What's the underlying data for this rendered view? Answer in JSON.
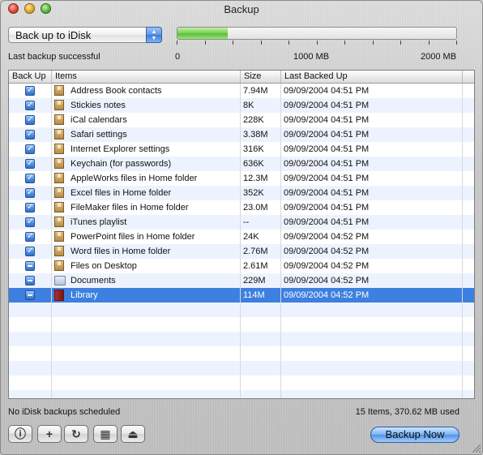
{
  "window": {
    "title": "Backup"
  },
  "destination": {
    "selected": "Back up to iDisk"
  },
  "status": {
    "last_backup": "Last backup successful"
  },
  "progress": {
    "fraction": 0.18,
    "labels": [
      "0",
      "1000 MB",
      "2000 MB"
    ]
  },
  "table": {
    "columns": [
      "Back Up",
      "Items",
      "Size",
      "Last Backed Up"
    ],
    "rows": [
      {
        "check": "on",
        "icon": "package-icon",
        "item": "Address Book contacts",
        "size": "7.94M",
        "date": "09/09/2004 04:51 PM"
      },
      {
        "check": "on",
        "icon": "package-icon",
        "item": "Stickies notes",
        "size": "8K",
        "date": "09/09/2004 04:51 PM"
      },
      {
        "check": "on",
        "icon": "package-icon",
        "item": "iCal calendars",
        "size": "228K",
        "date": "09/09/2004 04:51 PM"
      },
      {
        "check": "on",
        "icon": "package-icon",
        "item": "Safari settings",
        "size": "3.38M",
        "date": "09/09/2004 04:51 PM"
      },
      {
        "check": "on",
        "icon": "package-icon",
        "item": "Internet Explorer settings",
        "size": "316K",
        "date": "09/09/2004 04:51 PM"
      },
      {
        "check": "on",
        "icon": "package-icon",
        "item": "Keychain (for passwords)",
        "size": "636K",
        "date": "09/09/2004 04:51 PM"
      },
      {
        "check": "on",
        "icon": "package-icon",
        "item": "AppleWorks files in Home folder",
        "size": "12.3M",
        "date": "09/09/2004 04:51 PM"
      },
      {
        "check": "on",
        "icon": "package-icon",
        "item": "Excel files in Home folder",
        "size": "352K",
        "date": "09/09/2004 04:51 PM"
      },
      {
        "check": "on",
        "icon": "package-icon",
        "item": "FileMaker files in Home folder",
        "size": "23.0M",
        "date": "09/09/2004 04:51 PM"
      },
      {
        "check": "on",
        "icon": "package-icon",
        "item": "iTunes playlist",
        "size": "--",
        "date": "09/09/2004 04:51 PM"
      },
      {
        "check": "on",
        "icon": "package-icon",
        "item": "PowerPoint files in Home folder",
        "size": "24K",
        "date": "09/09/2004 04:52 PM"
      },
      {
        "check": "on",
        "icon": "package-icon",
        "item": "Word files in Home folder",
        "size": "2.76M",
        "date": "09/09/2004 04:52 PM"
      },
      {
        "check": "mixed",
        "icon": "package-icon",
        "item": "Files on Desktop",
        "size": "2.61M",
        "date": "09/09/2004 04:52 PM"
      },
      {
        "check": "mixed",
        "icon": "folder-icon",
        "item": "Documents",
        "size": "229M",
        "date": "09/09/2004 04:52 PM"
      },
      {
        "check": "mixed",
        "icon": "library-book-icon",
        "item": "Library",
        "size": "114M",
        "date": "09/09/2004 04:52 PM",
        "selected": true
      }
    ]
  },
  "footer": {
    "schedule": "No iDisk backups scheduled",
    "summary": "15 Items, 370.62 MB used",
    "backup_now": "Backup Now",
    "tools": [
      "info-icon",
      "add-icon",
      "refresh-icon",
      "calendar-icon",
      "eject-icon"
    ]
  },
  "colors": {
    "selection": "#3d80df",
    "stripe": "#edf3fe",
    "progress": "#7fd35a"
  }
}
